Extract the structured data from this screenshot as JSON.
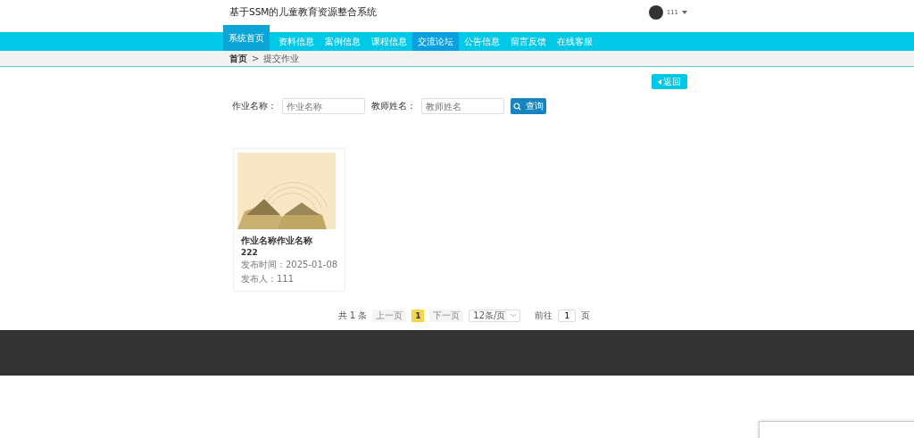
{
  "header": {
    "title": "基于SSM的儿童教育资源整合系统",
    "user": "111"
  },
  "nav": [
    {
      "label": "系统首页",
      "selected": true,
      "hovered": false
    },
    {
      "label": "资料信息",
      "selected": false,
      "hovered": false
    },
    {
      "label": "案例信息",
      "selected": false,
      "hovered": false
    },
    {
      "label": "课程信息",
      "selected": false,
      "hovered": false
    },
    {
      "label": "交流论坛",
      "selected": false,
      "hovered": true
    },
    {
      "label": "公告信息",
      "selected": false,
      "hovered": false
    },
    {
      "label": "留言反馈",
      "selected": false,
      "hovered": false
    },
    {
      "label": "在线客服",
      "selected": false,
      "hovered": false
    }
  ],
  "breadcrumb": {
    "home": "首页",
    "separator": ">",
    "current": "提交作业"
  },
  "back_button": "返回",
  "search": {
    "fields": [
      {
        "label": "作业名称：",
        "placeholder": "作业名称"
      },
      {
        "label": "教师姓名：",
        "placeholder": "教师姓名"
      }
    ],
    "button": "查询"
  },
  "cards": [
    {
      "title": "作业名称作业名称",
      "subtitle": "222",
      "date": "发布时间：2025-01-08",
      "author": "发布人：111"
    }
  ],
  "pagination": {
    "total": "共 1 条",
    "prev": "上一页",
    "pages": [
      {
        "label": "1",
        "selected": true
      }
    ],
    "next": "下一页",
    "page_size": "12条/页",
    "goto": "前往",
    "goto_value": "1",
    "page_unit": "页"
  }
}
